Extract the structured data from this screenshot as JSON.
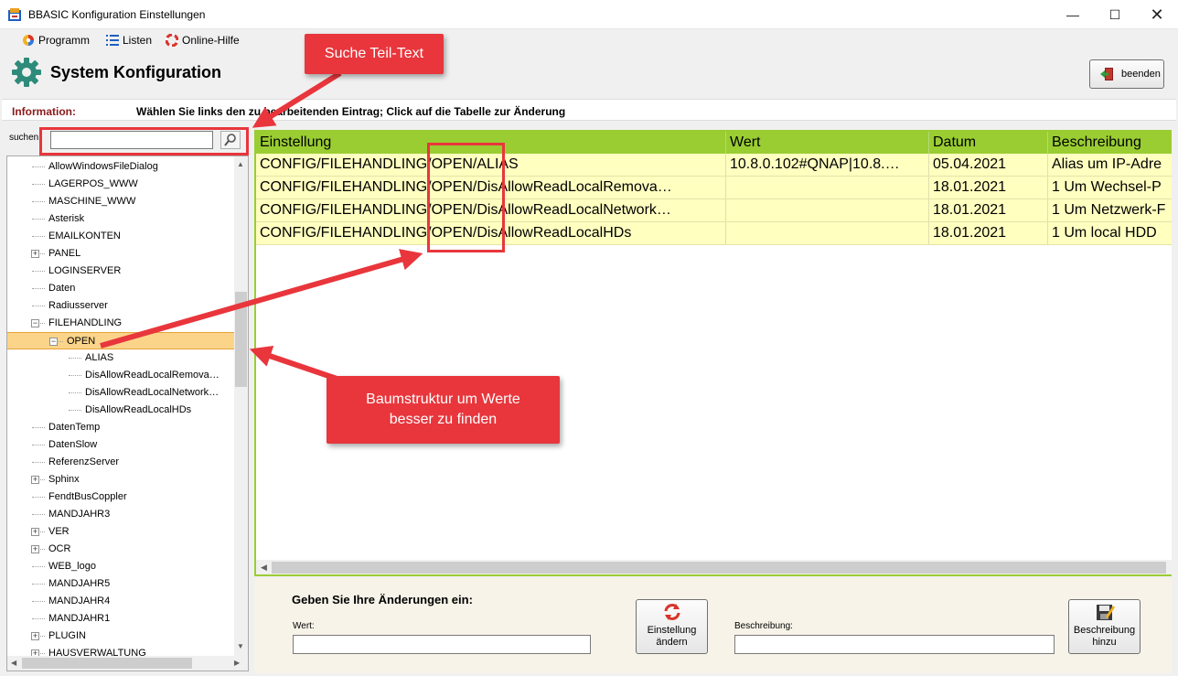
{
  "window": {
    "title": "BBASIC Konfiguration Einstellungen",
    "controls": {
      "minimize": "—",
      "maximize": "☐",
      "close": "✕"
    }
  },
  "menu": {
    "items": [
      {
        "label": "Programm",
        "icon": "program-icon"
      },
      {
        "label": "Listen",
        "icon": "list-icon"
      },
      {
        "label": "Online-Hilfe",
        "icon": "lifebuoy-icon"
      }
    ]
  },
  "header": {
    "title": "System Konfiguration",
    "exit_label": "beenden"
  },
  "info": {
    "label": "Information:",
    "text": "Wählen Sie links den zu bearbeitenden Eintrag; Click auf die Tabelle zur Änderung"
  },
  "search": {
    "label": "suchen:",
    "value": ""
  },
  "tree": {
    "items": [
      {
        "label": "AllowWindowsFileDialog",
        "level": 1,
        "expander": ""
      },
      {
        "label": "LAGERPOS_WWW",
        "level": 1,
        "expander": ""
      },
      {
        "label": "MASCHINE_WWW",
        "level": 1,
        "expander": ""
      },
      {
        "label": "Asterisk",
        "level": 1,
        "expander": ""
      },
      {
        "label": "EMAILKONTEN",
        "level": 1,
        "expander": ""
      },
      {
        "label": "PANEL",
        "level": 1,
        "expander": "+"
      },
      {
        "label": "LOGINSERVER",
        "level": 1,
        "expander": ""
      },
      {
        "label": "Daten",
        "level": 1,
        "expander": ""
      },
      {
        "label": "Radiusserver",
        "level": 1,
        "expander": ""
      },
      {
        "label": "FILEHANDLING",
        "level": 1,
        "expander": "−"
      },
      {
        "label": "OPEN",
        "level": 2,
        "expander": "−",
        "selected": true
      },
      {
        "label": "ALIAS",
        "level": 3,
        "expander": ""
      },
      {
        "label": "DisAllowReadLocalRemova…",
        "level": 3,
        "expander": ""
      },
      {
        "label": "DisAllowReadLocalNetwork…",
        "level": 3,
        "expander": ""
      },
      {
        "label": "DisAllowReadLocalHDs",
        "level": 3,
        "expander": ""
      },
      {
        "label": "DatenTemp",
        "level": 1,
        "expander": ""
      },
      {
        "label": "DatenSlow",
        "level": 1,
        "expander": ""
      },
      {
        "label": "ReferenzServer",
        "level": 1,
        "expander": ""
      },
      {
        "label": "Sphinx",
        "level": 1,
        "expander": "+"
      },
      {
        "label": "FendtBusCoppler",
        "level": 1,
        "expander": ""
      },
      {
        "label": "MANDJAHR3",
        "level": 1,
        "expander": ""
      },
      {
        "label": "VER",
        "level": 1,
        "expander": "+"
      },
      {
        "label": "OCR",
        "level": 1,
        "expander": "+"
      },
      {
        "label": "WEB_logo",
        "level": 1,
        "expander": ""
      },
      {
        "label": "MANDJAHR5",
        "level": 1,
        "expander": ""
      },
      {
        "label": "MANDJAHR4",
        "level": 1,
        "expander": ""
      },
      {
        "label": "MANDJAHR1",
        "level": 1,
        "expander": ""
      },
      {
        "label": "PLUGIN",
        "level": 1,
        "expander": "+"
      },
      {
        "label": "HAUSVERWALTUNG",
        "level": 1,
        "expander": "+"
      }
    ]
  },
  "table": {
    "columns": [
      "Einstellung",
      "Wert",
      "Datum",
      "Beschreibung"
    ],
    "rows": [
      [
        "CONFIG/FILEHANDLING/OPEN/ALIAS",
        "10.8.0.102#QNAP|10.8.…",
        "05.04.2021",
        "Alias  um  IP-Adre"
      ],
      [
        "CONFIG/FILEHANDLING/OPEN/DisAllowReadLocalRemova…",
        "",
        "18.01.2021",
        "1  Um  Wechsel-P"
      ],
      [
        "CONFIG/FILEHANDLING/OPEN/DisAllowReadLocalNetwork…",
        "",
        "18.01.2021",
        "1  Um  Netzwerk-F"
      ],
      [
        "CONFIG/FILEHANDLING/OPEN/DisAllowReadLocalHDs",
        "",
        "18.01.2021",
        "1  Um  local  HDD"
      ]
    ]
  },
  "edit": {
    "title": "Geben Sie Ihre Änderungen ein:",
    "wert_label": "Wert:",
    "wert_value": "",
    "change_button": [
      "Einstellung",
      "ändern"
    ],
    "beschreibung_label": "Beschreibung:",
    "beschreibung_value": "",
    "add_button": [
      "Beschreibung",
      "hinzu"
    ]
  },
  "annotations": {
    "search_callout": "Suche Teil-Text",
    "tree_callout": [
      "Baumstruktur um Werte",
      "besser zu finden"
    ]
  },
  "colors": {
    "table_header": "#9acd32",
    "table_row": "#ffffc0",
    "tree_selected": "#fbd48a",
    "annotation_red": "#e8363c",
    "info_label": "#8b1a1a"
  }
}
